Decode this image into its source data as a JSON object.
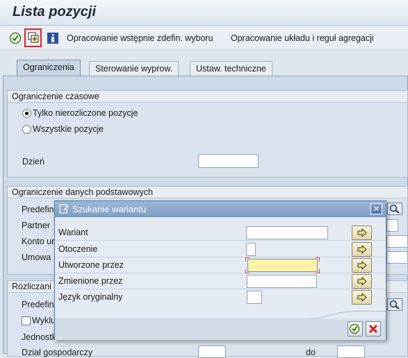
{
  "window": {
    "title": "Lista pozycji"
  },
  "toolbar": {
    "items": [
      {
        "label": "Opracowanie wstępnie zdefin. wyboru"
      },
      {
        "label": "Opracowanie układu i reguł agregacji"
      }
    ]
  },
  "tabs": [
    {
      "label": "Ograniczenia"
    },
    {
      "label": "Sterowanie wyprow."
    },
    {
      "label": "Ustaw. techniczne"
    }
  ],
  "group_time": {
    "title": "Ograniczenie czasowe",
    "radio1": "Tylko nierozliczone pozycje",
    "radio2": "Wszystkie pozycje",
    "day_label": "Dzień"
  },
  "group_master": {
    "title": "Ograniczenie danych podstawowych",
    "rows": [
      "Predefin",
      "Partner",
      "Konto ur",
      "Umowa"
    ]
  },
  "group_settle": {
    "title": "Rozliczani",
    "rows": [
      "Predefin",
      "Wyklu",
      "Jednostk",
      "Dział gospodarczy"
    ],
    "to_label": "do"
  },
  "dialog": {
    "title": "Szukanie wariantu",
    "fields": [
      {
        "label": "Wariant",
        "value": ""
      },
      {
        "label": "Otoczenie",
        "value": ""
      },
      {
        "label": "Utworzone przez",
        "value": ""
      },
      {
        "label": "Zmienione przez",
        "value": ""
      },
      {
        "label": "Język oryginalny",
        "value": ""
      }
    ]
  },
  "colors": {
    "accent": "#7d9ec4",
    "required_field": "#fff3a8",
    "arrow_button": "#e0d9b4"
  }
}
